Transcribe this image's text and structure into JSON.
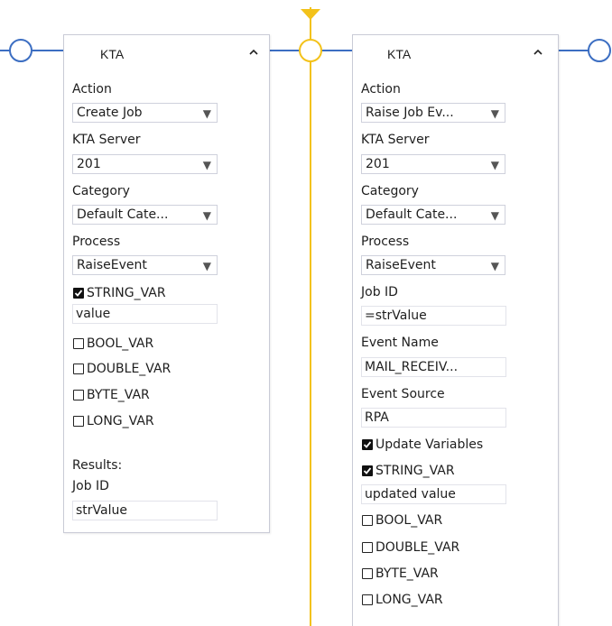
{
  "cards": [
    {
      "title": "KTA",
      "action_label": "Action",
      "action_value": "Create Job",
      "server_label": "KTA Server",
      "server_value": "201",
      "category_label": "Category",
      "category_value": "Default Cate...",
      "process_label": "Process",
      "process_value": "RaiseEvent",
      "var_string": "STRING_VAR",
      "var_string_value": "value",
      "var_bool": "BOOL_VAR",
      "var_double": "DOUBLE_VAR",
      "var_byte": "BYTE_VAR",
      "var_long": "LONG_VAR",
      "results_label": "Results:",
      "jobid_label": "Job ID",
      "jobid_value": "strValue"
    },
    {
      "title": "KTA",
      "action_label": "Action",
      "action_value": "Raise Job Ev...",
      "server_label": "KTA Server",
      "server_value": "201",
      "category_label": "Category",
      "category_value": "Default Cate...",
      "process_label": "Process",
      "process_value": "RaiseEvent",
      "jobid_label": "Job ID",
      "jobid_value": "=strValue",
      "event_name_label": "Event Name",
      "event_name_value": "MAIL_RECEIV...",
      "event_source_label": "Event Source",
      "event_source_value": "RPA",
      "update_vars_label": "Update Variables",
      "var_string": "STRING_VAR",
      "var_string_value": "updated value",
      "var_bool": "BOOL_VAR",
      "var_double": "DOUBLE_VAR",
      "var_byte": "BYTE_VAR",
      "var_long": "LONG_VAR"
    }
  ],
  "colors": {
    "connector": "#3c6ec2",
    "flow": "#f3c21a"
  },
  "icons": {
    "collapse": "chevron-up-icon",
    "dropdown": "triangle-down-icon",
    "checked": "checkbox-checked-icon",
    "unchecked": "checkbox-unchecked-icon"
  }
}
